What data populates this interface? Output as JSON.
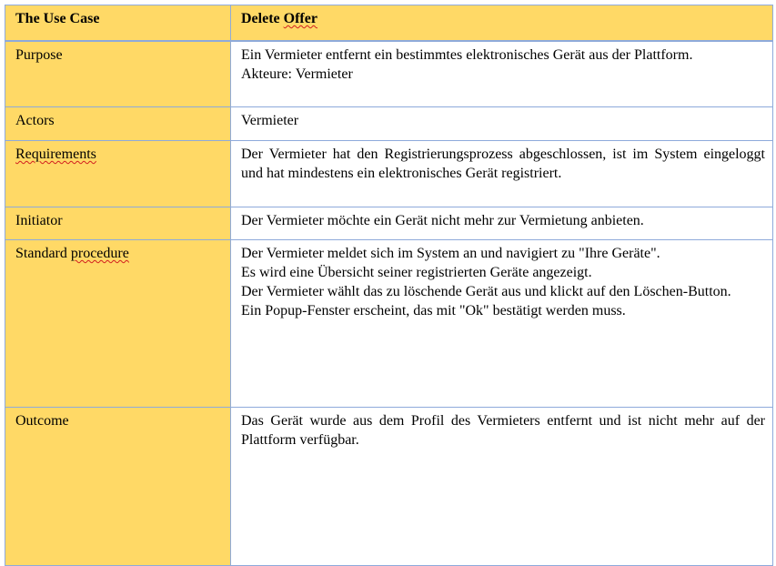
{
  "header": {
    "label": "The Use Case",
    "title_word": "Delete",
    "title_word_underlined": "Offer"
  },
  "rows": [
    {
      "label": "Purpose",
      "lines": [
        "Ein Vermieter entfernt ein bestimmtes elektronisches Gerät aus der Plattform.",
        "Akteure: Vermieter"
      ]
    },
    {
      "label": "Actors",
      "lines": [
        "Vermieter"
      ]
    },
    {
      "label": "Requirements",
      "text": "Der Vermieter hat den Registrierungsprozess abgeschlossen, ist im System eingeloggt und hat mindestens ein elektronisches Gerät registriert."
    },
    {
      "label": "Initiator",
      "lines": [
        "Der Vermieter möchte ein Gerät nicht mehr zur Vermietung anbieten."
      ]
    },
    {
      "label_word": "Standard",
      "label_word_underlined": "procedure",
      "lines": [
        "Der Vermieter meldet sich im System an und navigiert zu \"Ihre Geräte\".",
        "Es wird eine Übersicht seiner registrierten Geräte angezeigt.",
        "Der Vermieter wählt das zu löschende Gerät aus und klickt auf den Löschen-Button.",
        "Ein Popup-Fenster erscheint, das mit \"Ok\" bestätigt werden muss."
      ]
    },
    {
      "label": "Outcome",
      "text": "Das Gerät wurde aus dem Profil des Vermieters entfernt und ist nicht mehr auf der Plattform verfügbar."
    }
  ],
  "colors": {
    "label_fill": "#ffd966",
    "border": "#8eaadb",
    "spellcheck": "#d21f1f"
  }
}
